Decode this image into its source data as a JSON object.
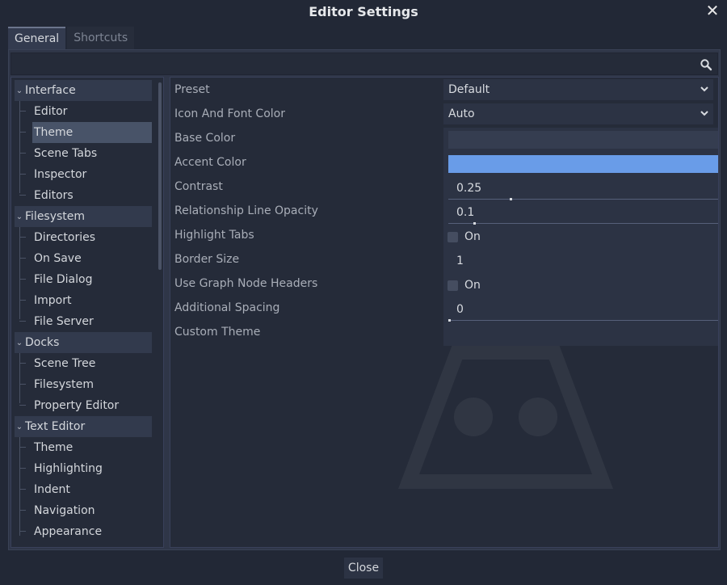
{
  "window": {
    "title": "Editor Settings",
    "close_icon": "close-icon"
  },
  "tabs": [
    {
      "label": "General",
      "active": true
    },
    {
      "label": "Shortcuts",
      "active": false
    }
  ],
  "search": {
    "value": "",
    "icon": "search-icon"
  },
  "sidebar": {
    "sections": [
      {
        "label": "Interface",
        "items": [
          "Editor",
          "Theme",
          "Scene Tabs",
          "Inspector",
          "Editors"
        ]
      },
      {
        "label": "Filesystem",
        "items": [
          "Directories",
          "On Save",
          "File Dialog",
          "Import",
          "File Server"
        ]
      },
      {
        "label": "Docks",
        "items": [
          "Scene Tree",
          "Filesystem",
          "Property Editor"
        ]
      },
      {
        "label": "Text Editor",
        "items": [
          "Theme",
          "Highlighting",
          "Indent",
          "Navigation",
          "Appearance"
        ]
      }
    ],
    "selected": "Interface/Theme"
  },
  "properties": {
    "preset": {
      "label": "Preset",
      "value": "Default"
    },
    "icon_font_color": {
      "label": "Icon And Font Color",
      "value": "Auto"
    },
    "base_color": {
      "label": "Base Color",
      "color": "#353d50"
    },
    "accent_color": {
      "label": "Accent Color",
      "color": "#699ce8"
    },
    "contrast": {
      "label": "Contrast",
      "value": "0.25",
      "fraction": 0.25
    },
    "relationship_line_opacity": {
      "label": "Relationship Line Opacity",
      "value": "0.1",
      "fraction": 0.1
    },
    "highlight_tabs": {
      "label": "Highlight Tabs",
      "value": "On",
      "checked": false
    },
    "border_size": {
      "label": "Border Size",
      "value": "1"
    },
    "graph_node_headers": {
      "label": "Use Graph Node Headers",
      "value": "On",
      "checked": false
    },
    "additional_spacing": {
      "label": "Additional Spacing",
      "value": "0",
      "fraction": 0
    },
    "custom_theme": {
      "label": "Custom Theme",
      "value": ""
    }
  },
  "footer": {
    "close_label": "Close"
  }
}
